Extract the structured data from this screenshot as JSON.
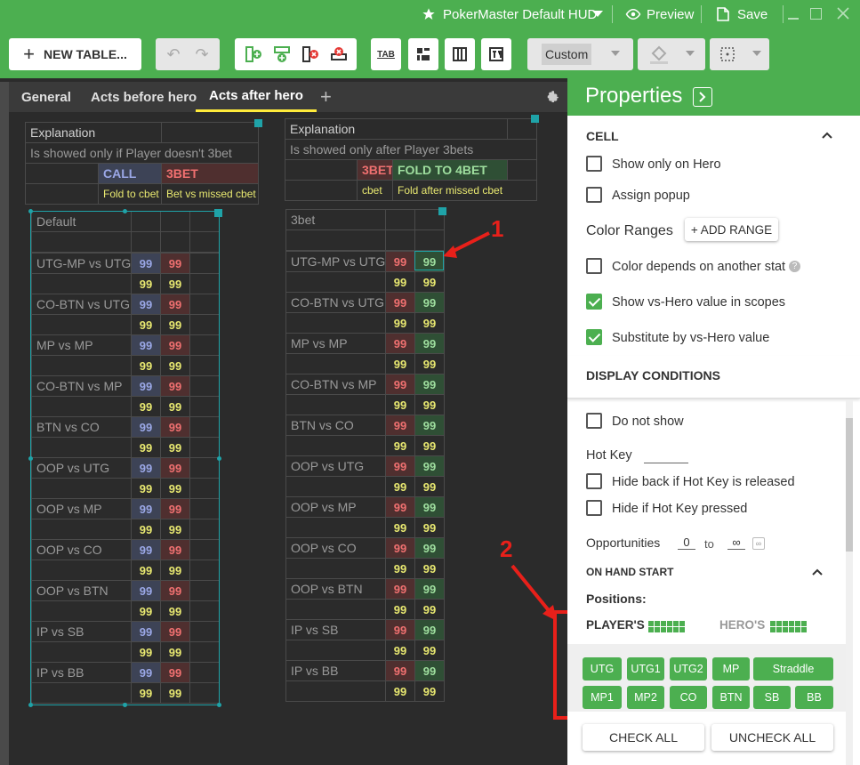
{
  "titlebar": {
    "hud_name": "PokerMaster Default HUD",
    "preview_label": "Preview",
    "save_label": "Save"
  },
  "toolbar": {
    "new_table_label": "NEW TABLE...",
    "tab_icon_label": "TAB",
    "preset_value": "Custom"
  },
  "tabs": [
    {
      "label": "General"
    },
    {
      "label": "Acts before hero"
    },
    {
      "label": "Acts after hero"
    }
  ],
  "table1": {
    "explanation_label": "Explanation",
    "explanation_text": "Is showed only if Player doesn't 3bet",
    "col_call": "CALL",
    "col_3bet": "3BET",
    "sub_call": "Fold to cbet",
    "sub_3bet": "Bet vs missed cbet"
  },
  "table2": {
    "explanation_label": "Explanation",
    "explanation_text": "Is showed only after Player 3bets",
    "col_3bet": "3BET",
    "col_fold4": "FOLD TO 4BET",
    "sub_3bet": "cbet",
    "sub_fold4": "Fold after missed cbet"
  },
  "grid_left": {
    "header": "Default",
    "rows": [
      "UTG-MP vs UTG",
      "CO-BTN vs UTG",
      "MP vs MP",
      "CO-BTN vs MP",
      "BTN vs CO",
      "OOP vs UTG",
      "OOP vs MP",
      "OOP vs CO",
      "OOP vs BTN",
      "IP vs SB",
      "IP vs BB"
    ],
    "value": "99"
  },
  "grid_right": {
    "header": "3bet",
    "rows": [
      "UTG-MP vs UTG",
      "CO-BTN vs UTG",
      "MP vs MP",
      "CO-BTN vs MP",
      "BTN vs CO",
      "OOP vs UTG",
      "OOP vs MP",
      "OOP vs CO",
      "OOP vs BTN",
      "IP vs SB",
      "IP vs BB"
    ],
    "value": "99"
  },
  "annotations": {
    "marker1": "1",
    "marker2": "2",
    "color": "#e8201a"
  },
  "properties": {
    "title": "Properties",
    "cell_section": "CELL",
    "show_only_on_hero": "Show only on Hero",
    "assign_popup": "Assign popup",
    "color_ranges": "Color Ranges",
    "add_range": "+ ADD RANGE",
    "color_depends": "Color depends on another stat",
    "show_vs_hero": "Show vs-Hero value in scopes",
    "substitute": "Substitute by vs-Hero value",
    "display_conditions": "DISPLAY CONDITIONS",
    "do_not_show": "Do not show",
    "hot_key": "Hot Key",
    "hide_back": "Hide back if Hot Key is released",
    "hide_if_pressed": "Hide if Hot Key pressed",
    "opportunities": "Opportunities",
    "opp_from": "0",
    "opp_to_word": "to",
    "opp_to": "∞",
    "on_hand_start": "ON HAND START",
    "positions": "Positions:",
    "players": "PLAYER'S",
    "heros": "HERO'S",
    "position_buttons_row1": [
      "UTG",
      "UTG1",
      "UTG2",
      "MP",
      "Straddle"
    ],
    "position_buttons_row2": [
      "MP1",
      "MP2",
      "CO",
      "BTN",
      "SB",
      "BB"
    ],
    "check_all": "CHECK ALL",
    "uncheck_all": "UNCHECK ALL"
  },
  "colors": {
    "accent": "#4caf50",
    "canvas": "#2b2b2b",
    "blue_stat": "#9aa7e6",
    "red_stat": "#f07070",
    "green_stat": "#9fdf9f",
    "yellow_stat": "#e8e870"
  }
}
